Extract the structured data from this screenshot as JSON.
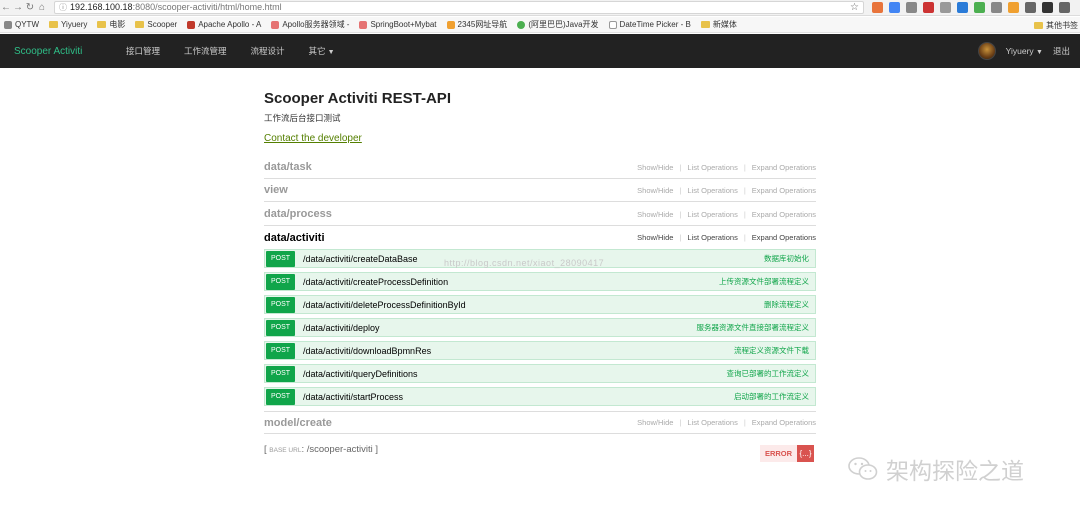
{
  "browser": {
    "url_host": "192.168.100.18",
    "url_rest": ":8080/scooper-activiti/html/home.html",
    "bookmarks": [
      "QYTW",
      "Yiyuery",
      "电影",
      "Scooper",
      "Apache Apollo - A",
      "Apollo服务器领域 -",
      "SpringBoot+Mybat",
      "2345网址导航",
      "(阿里巴巴)Java开发",
      "DateTime Picker - B",
      "新媒体"
    ],
    "other_bookmarks": "其他书签"
  },
  "navbar": {
    "brand": "Scooper Activiti",
    "items": [
      "接口管理",
      "工作流管理",
      "流程设计",
      "其它"
    ],
    "username": "Yiyuery",
    "logout": "退出"
  },
  "info": {
    "title": "Scooper Activiti REST-API",
    "subtitle": "工作流后台接口测试",
    "contact": "Contact the developer"
  },
  "operations_labels": {
    "show_hide": "Show/Hide",
    "list_ops": "List Operations",
    "expand_ops": "Expand Operations"
  },
  "resources": [
    {
      "name": "data/task",
      "active": false
    },
    {
      "name": "view",
      "active": false
    },
    {
      "name": "data/process",
      "active": false
    },
    {
      "name": "data/activiti",
      "active": true
    },
    {
      "name": "model/create",
      "active": false
    }
  ],
  "operations": [
    {
      "method": "POST",
      "path": "/data/activiti/createDataBase",
      "summary": "数据库初始化"
    },
    {
      "method": "POST",
      "path": "/data/activiti/createProcessDefinition",
      "summary": "上传资源文件部署流程定义"
    },
    {
      "method": "POST",
      "path": "/data/activiti/deleteProcessDefinitionById",
      "summary": "删除流程定义"
    },
    {
      "method": "POST",
      "path": "/data/activiti/deploy",
      "summary": "服务器资源文件直接部署流程定义"
    },
    {
      "method": "POST",
      "path": "/data/activiti/downloadBpmnRes",
      "summary": "流程定义资源文件下载"
    },
    {
      "method": "POST",
      "path": "/data/activiti/queryDefinitions",
      "summary": "查询已部署的工作流定义"
    },
    {
      "method": "POST",
      "path": "/data/activiti/startProcess",
      "summary": "启动部署的工作流定义"
    }
  ],
  "watermark": "http://blog.csdn.net/xiaot_28090417",
  "footer": {
    "base_url_label": "BASE URL",
    "base_url": "/scooper-activiti",
    "error_label": "ERROR",
    "error_icon": "{...}"
  },
  "wechat_watermark": "架构探险之道",
  "colors": {
    "navbar_bg": "#222222",
    "brand": "#2fbf88",
    "post_method": "#10a54a",
    "post_bg": "#e7f6ec",
    "contact_link": "#547f00",
    "error": "#d9534f"
  }
}
